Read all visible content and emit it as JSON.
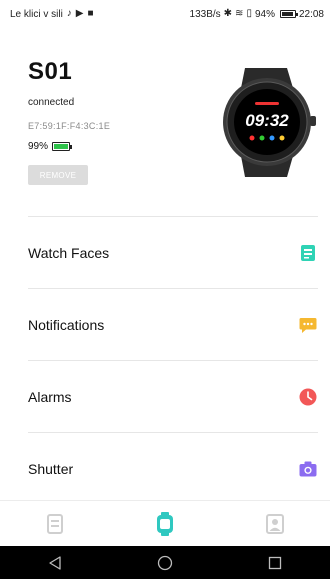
{
  "status_bar": {
    "carrier": "Le klici v sili",
    "speed": "133B/s",
    "battery": "94%",
    "time": "22:08"
  },
  "device": {
    "name": "S01",
    "connection": "connected",
    "mac": "E7:59:1F:F4:3C:1E",
    "battery": "99%",
    "battery_level": 0.99,
    "remove_label": "REMOVE",
    "watch_time": "09:32"
  },
  "menu": {
    "items": [
      {
        "label": "Watch Faces",
        "icon": "watch-face-icon",
        "color": "#2fd3b5"
      },
      {
        "label": "Notifications",
        "icon": "message-icon",
        "color": "#f5b830"
      },
      {
        "label": "Alarms",
        "icon": "clock-icon",
        "color": "#f25757"
      },
      {
        "label": "Shutter",
        "icon": "camera-icon",
        "color": "#8b6cf0"
      }
    ]
  },
  "bottom_nav": {
    "items": [
      {
        "name": "tab-dashboard",
        "icon": "dashboard-icon",
        "active": false
      },
      {
        "name": "tab-device",
        "icon": "watch-icon",
        "active": true
      },
      {
        "name": "tab-profile",
        "icon": "profile-icon",
        "active": false
      }
    ],
    "active_color": "#2fc8c0",
    "inactive_color": "#cfcfcf"
  }
}
